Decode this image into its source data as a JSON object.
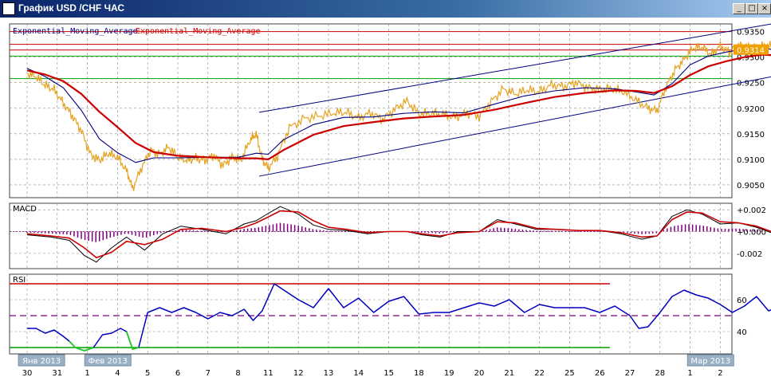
{
  "window": {
    "title": "График USD /CHF ЧАС",
    "buttons": {
      "minimize": "_",
      "maximize": "□",
      "close": "×"
    }
  },
  "colors": {
    "price": "#e6a21e",
    "ema_fast": "#000080",
    "ema_slow": "#cc0000",
    "support": "#00a000",
    "channel": "#000080",
    "macd_hist": "#800080",
    "rsi": "#0000c0",
    "rsi_oversold": "#22cc22",
    "grid": "#8a8a8a",
    "price_tag_bg": "#f0a000"
  },
  "chart_data": [
    {
      "type": "line",
      "panel": "price",
      "legend": [
        "Exponential_Moving_Average",
        "Exponential_Moving_Average"
      ],
      "ylim": [
        0.9025,
        0.9365
      ],
      "yticks": [
        0.935,
        0.93,
        0.925,
        0.92,
        0.915,
        0.91,
        0.905
      ],
      "ytick_labels": [
        "0.9350",
        "0.9300",
        "0.9250",
        "0.9200",
        "0.9150",
        "0.9100",
        "0.9050"
      ],
      "current_price_label": "0.9314",
      "current_price": 0.9314,
      "hlines": [
        {
          "value": 0.935,
          "color": "#cc0000"
        },
        {
          "value": 0.9325,
          "color": "#cc0000"
        },
        {
          "value": 0.9314,
          "color": "#cc0000"
        },
        {
          "value": 0.9302,
          "color": "#00a000"
        },
        {
          "value": 0.9258,
          "color": "#00a000"
        }
      ],
      "channel": [
        {
          "x": [
            7.7,
            25.2
          ],
          "y": [
            0.9192,
            0.937
          ]
        },
        {
          "x": [
            7.7,
            27.0
          ],
          "y": [
            0.9067,
            0.9288
          ]
        }
      ],
      "series": [
        {
          "key": "price",
          "x": [
            0,
            0.3,
            0.6,
            0.9,
            1.2,
            1.5,
            1.8,
            2.1,
            2.4,
            2.7,
            3.0,
            3.3,
            3.5,
            3.8,
            4.1,
            4.4,
            4.7,
            5.0,
            5.3,
            5.6,
            5.9,
            6.2,
            6.5,
            6.8,
            7.1,
            7.4,
            7.6,
            7.8,
            8.0,
            8.3,
            8.7,
            9.2,
            9.7,
            10.2,
            10.6,
            11.0,
            11.4,
            11.8,
            12.2,
            12.6,
            13.0,
            13.4,
            13.8,
            14.2,
            14.6,
            15.0,
            15.4,
            15.8,
            16.2,
            16.6,
            17.0,
            17.4,
            17.8,
            18.2,
            18.6,
            19.0,
            19.4,
            19.8,
            20.2,
            20.6,
            20.9,
            21.2,
            21.5,
            21.8,
            22.1,
            22.4,
            22.7,
            23.0,
            23.3,
            23.6,
            23.9,
            24.2,
            24.5,
            24.8,
            25.1,
            25.4,
            25.7,
            26.0,
            26.3,
            26.6,
            26.8
          ],
          "values": [
            0.9268,
            0.9262,
            0.9245,
            0.9236,
            0.921,
            0.9185,
            0.9156,
            0.911,
            0.9098,
            0.9112,
            0.9104,
            0.9078,
            0.9043,
            0.9084,
            0.9118,
            0.911,
            0.9124,
            0.9104,
            0.9098,
            0.9102,
            0.9098,
            0.9108,
            0.9088,
            0.9105,
            0.9098,
            0.9138,
            0.915,
            0.91,
            0.9083,
            0.9106,
            0.9162,
            0.918,
            0.9185,
            0.9191,
            0.9192,
            0.9181,
            0.9191,
            0.9178,
            0.9198,
            0.9214,
            0.9189,
            0.919,
            0.9188,
            0.9182,
            0.9191,
            0.9184,
            0.9213,
            0.9238,
            0.9228,
            0.9236,
            0.9232,
            0.9246,
            0.9242,
            0.9251,
            0.924,
            0.9237,
            0.9238,
            0.9232,
            0.9216,
            0.92,
            0.9195,
            0.9242,
            0.9275,
            0.9296,
            0.9318,
            0.932,
            0.9305,
            0.9322,
            0.931,
            0.9324,
            0.932,
            0.9318,
            0.9322,
            0.932,
            0.9316,
            0.9272,
            0.9245,
            0.93,
            0.9328,
            0.9319,
            0.9314
          ]
        },
        {
          "key": "ema_fast",
          "x": [
            0,
            0.6,
            1.2,
            1.8,
            2.4,
            3.0,
            3.6,
            4.2,
            5.0,
            6.0,
            7.0,
            7.6,
            8.0,
            8.5,
            9.5,
            10.5,
            11.5,
            12.5,
            13.5,
            14.5,
            15.5,
            16.5,
            17.5,
            18.5,
            19.5,
            20.2,
            20.8,
            21.4,
            22.0,
            22.6,
            23.2,
            23.8,
            24.4,
            25.0,
            25.5,
            26.0,
            26.4,
            26.8
          ],
          "values": [
            0.9278,
            0.9262,
            0.924,
            0.9196,
            0.914,
            0.9113,
            0.9094,
            0.9103,
            0.9103,
            0.9104,
            0.9104,
            0.9112,
            0.911,
            0.9138,
            0.9168,
            0.9182,
            0.9183,
            0.919,
            0.9193,
            0.9191,
            0.9208,
            0.9224,
            0.9234,
            0.924,
            0.9238,
            0.9232,
            0.9226,
            0.9248,
            0.9285,
            0.9302,
            0.931,
            0.9316,
            0.9318,
            0.9312,
            0.9298,
            0.93,
            0.9308,
            0.9308
          ]
        },
        {
          "key": "ema_slow",
          "x": [
            0,
            0.6,
            1.2,
            1.8,
            2.4,
            3.0,
            3.6,
            4.2,
            5.0,
            6.0,
            7.0,
            7.6,
            8.0,
            8.5,
            9.5,
            10.5,
            11.5,
            12.5,
            13.5,
            14.5,
            15.5,
            16.5,
            17.5,
            18.5,
            19.5,
            20.2,
            20.8,
            21.4,
            22.0,
            22.6,
            23.2,
            23.8,
            24.4,
            25.0,
            25.5,
            26.0,
            26.4,
            26.8
          ],
          "values": [
            0.9274,
            0.9266,
            0.9253,
            0.9228,
            0.9193,
            0.9163,
            0.9132,
            0.9114,
            0.9107,
            0.9104,
            0.9102,
            0.9102,
            0.91,
            0.9118,
            0.9148,
            0.9165,
            0.9173,
            0.918,
            0.9184,
            0.9187,
            0.9197,
            0.921,
            0.9222,
            0.923,
            0.9235,
            0.9234,
            0.923,
            0.9243,
            0.9265,
            0.9282,
            0.9292,
            0.93,
            0.9305,
            0.9303,
            0.9295,
            0.9291,
            0.9297,
            0.9302
          ]
        }
      ]
    },
    {
      "type": "line",
      "panel": "macd",
      "title": "MACD",
      "ylim": [
        -0.0034,
        0.0026
      ],
      "yticks": [
        0.002,
        0.0,
        -0.002
      ],
      "ytick_labels": [
        "+0.002",
        "+0.000",
        "-0.002"
      ],
      "series": [
        {
          "key": "macd_main",
          "x": [
            0,
            0.8,
            1.4,
            1.9,
            2.3,
            2.8,
            3.3,
            3.9,
            4.5,
            5.1,
            5.8,
            6.6,
            7.2,
            7.6,
            7.9,
            8.4,
            9.0,
            9.5,
            10.0,
            10.6,
            11.3,
            12.0,
            12.6,
            13.1,
            13.7,
            14.3,
            15.0,
            15.6,
            16.2,
            16.9,
            17.6,
            18.3,
            19.0,
            19.7,
            20.4,
            20.9,
            21.4,
            21.9,
            22.4,
            23.0,
            23.6,
            24.2,
            24.8,
            25.2,
            25.6,
            26.0,
            26.4,
            26.8
          ],
          "values": [
            -0.0003,
            -0.0005,
            -0.0008,
            -0.0022,
            -0.0028,
            -0.0015,
            -0.0005,
            -0.0017,
            -0.0002,
            0.0005,
            0.0002,
            -0.0002,
            0.0007,
            0.001,
            0.0015,
            0.0023,
            0.0016,
            0.0006,
            0.0002,
            0.0001,
            -0.0002,
            0.0,
            0.0,
            -0.0003,
            -0.0005,
            0.0,
            0.0,
            0.0011,
            0.0007,
            0.0002,
            0.0002,
            0.0001,
            0.0001,
            -0.0002,
            -0.0007,
            -0.0004,
            0.0014,
            0.002,
            0.0016,
            0.0007,
            0.0008,
            0.0004,
            -0.0002,
            -0.0012,
            -0.0009,
            0.0006,
            0.0007,
            0.0004
          ]
        },
        {
          "key": "macd_signal",
          "x": [
            0,
            0.8,
            1.4,
            1.9,
            2.3,
            2.8,
            3.3,
            3.9,
            4.5,
            5.1,
            5.8,
            6.6,
            7.2,
            7.6,
            7.9,
            8.4,
            9.0,
            9.5,
            10.0,
            10.6,
            11.3,
            12.0,
            12.6,
            13.1,
            13.7,
            14.3,
            15.0,
            15.6,
            16.2,
            16.9,
            17.6,
            18.3,
            19.0,
            19.7,
            20.4,
            20.9,
            21.4,
            21.9,
            22.4,
            23.0,
            23.6,
            24.2,
            24.8,
            25.2,
            25.6,
            26.0,
            26.4,
            26.8
          ],
          "values": [
            -0.0002,
            -0.0004,
            -0.0006,
            -0.0015,
            -0.0024,
            -0.0019,
            -0.0009,
            -0.0012,
            -0.0007,
            0.0002,
            0.0003,
            0.0,
            0.0004,
            0.0008,
            0.0012,
            0.0019,
            0.0018,
            0.001,
            0.0004,
            0.0002,
            -0.0001,
            0.0,
            0.0,
            -0.0002,
            -0.0004,
            -0.0001,
            0.0,
            0.0009,
            0.0008,
            0.0003,
            0.0002,
            0.0001,
            0.0001,
            -0.0001,
            -0.0005,
            -0.0004,
            0.0011,
            0.0018,
            0.0017,
            0.0009,
            0.0008,
            0.0005,
            -0.0001,
            -0.0009,
            -0.0007,
            0.0003,
            0.0006,
            0.0005
          ]
        }
      ]
    },
    {
      "type": "line",
      "panel": "rsi",
      "title": "RSI",
      "ylim": [
        26,
        76
      ],
      "yticks": [
        60,
        40
      ],
      "ytick_labels": [
        "60",
        "40"
      ],
      "hlines": [
        {
          "value": 70,
          "color": "#cc0000"
        },
        {
          "value": 50,
          "color": "#800080",
          "dashed": true
        },
        {
          "value": 30,
          "color": "#00a000"
        }
      ],
      "series": [
        {
          "key": "rsi",
          "x": [
            0,
            0.3,
            0.6,
            0.9,
            1.2,
            1.4,
            1.6,
            1.9,
            2.2,
            2.5,
            2.8,
            3.1,
            3.3,
            3.5,
            3.7,
            4.0,
            4.4,
            4.8,
            5.2,
            5.6,
            6.0,
            6.4,
            6.8,
            7.2,
            7.5,
            7.8,
            8.2,
            8.6,
            9.0,
            9.5,
            10.0,
            10.5,
            11.0,
            11.5,
            12.0,
            12.5,
            13.0,
            13.5,
            14.0,
            14.5,
            15.0,
            15.5,
            16.0,
            16.5,
            17.0,
            17.5,
            18.0,
            18.5,
            19.0,
            19.5,
            20.0,
            20.3,
            20.6,
            21.0,
            21.4,
            21.8,
            22.2,
            22.6,
            23.0,
            23.4,
            23.8,
            24.2,
            24.6,
            25.0,
            25.3,
            25.6,
            26.0,
            26.4,
            26.8
          ],
          "values": [
            42,
            42,
            39,
            41,
            37,
            34,
            30,
            28,
            30,
            38,
            39,
            42,
            40,
            29,
            30,
            52,
            55,
            52,
            55,
            52,
            48,
            52,
            50,
            54,
            47,
            53,
            70,
            65,
            60,
            55,
            67,
            55,
            61,
            52,
            59,
            62,
            51,
            52,
            52,
            55,
            58,
            56,
            60,
            52,
            57,
            55,
            55,
            55,
            52,
            56,
            50,
            42,
            43,
            52,
            62,
            66,
            63,
            61,
            57,
            52,
            56,
            62,
            53,
            56,
            37,
            46,
            58,
            57,
            55
          ]
        }
      ]
    }
  ],
  "xaxis": {
    "ticks": [
      {
        "x": 0,
        "label": "30"
      },
      {
        "x": 1,
        "label": "31"
      },
      {
        "x": 2,
        "label": "1"
      },
      {
        "x": 3,
        "label": "4"
      },
      {
        "x": 4,
        "label": "5"
      },
      {
        "x": 5,
        "label": "6"
      },
      {
        "x": 6,
        "label": "7"
      },
      {
        "x": 7,
        "label": "8"
      },
      {
        "x": 8,
        "label": "11"
      },
      {
        "x": 9,
        "label": "12"
      },
      {
        "x": 10,
        "label": "13"
      },
      {
        "x": 11,
        "label": "14"
      },
      {
        "x": 12,
        "label": "15"
      },
      {
        "x": 13,
        "label": "18"
      },
      {
        "x": 14,
        "label": "19"
      },
      {
        "x": 15,
        "label": "20"
      },
      {
        "x": 16,
        "label": "21"
      },
      {
        "x": 17,
        "label": "22"
      },
      {
        "x": 18,
        "label": "25"
      },
      {
        "x": 19,
        "label": "26"
      },
      {
        "x": 20,
        "label": "27"
      },
      {
        "x": 21,
        "label": "28"
      },
      {
        "x": 22,
        "label": "1"
      },
      {
        "x": 23,
        "label": "2"
      }
    ],
    "month_labels": [
      {
        "x": 0.4,
        "label": "Янв 2013"
      },
      {
        "x": 2.6,
        "label": "Фев 2013"
      },
      {
        "x": 22.6,
        "label": "Мар 2013"
      }
    ]
  }
}
